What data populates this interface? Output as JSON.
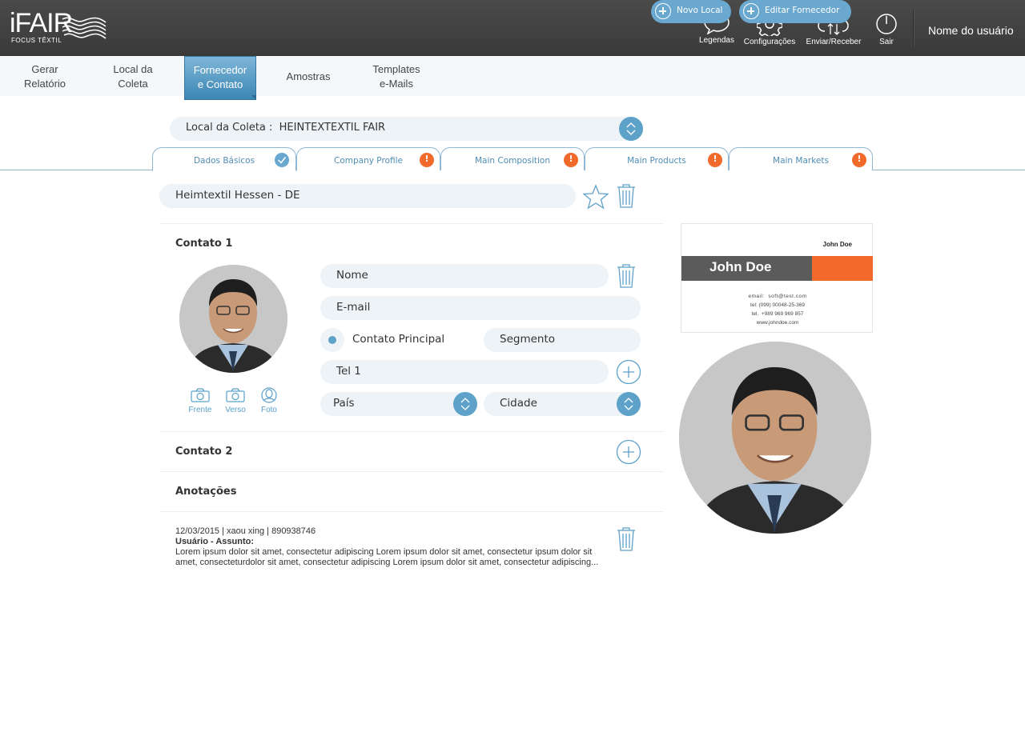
{
  "app": {
    "logo": "iFAIR",
    "logo_sub": "FOCUS TÊXTIL",
    "user_name": "Nome do usuário"
  },
  "top_actions": [
    {
      "label": "Legendas",
      "icon": "speech-bubble-icon"
    },
    {
      "label": "Configurações",
      "icon": "gear-icon"
    },
    {
      "label": "Enviar/Receber",
      "icon": "cloud-sync-icon"
    },
    {
      "label": "Sair",
      "icon": "power-icon"
    }
  ],
  "nav": [
    {
      "label": "Gerar\nRelatório"
    },
    {
      "label": "Local da\nColeta"
    },
    {
      "label": "Fornecedor\ne Contato",
      "active": true
    },
    {
      "label": "Amostras"
    },
    {
      "label": "Templates\ne-Mails"
    }
  ],
  "collection": {
    "label": "Local da Coleta :  HEINTEXTEXTIL FAIR",
    "new_place": "Novo Local",
    "edit_supplier": "Editar Fornecedor"
  },
  "subtabs": [
    {
      "label": "Dados Básicos",
      "status": "ok"
    },
    {
      "label": "Company Profile",
      "status": "warn"
    },
    {
      "label": "Main Composition",
      "status": "warn"
    },
    {
      "label": "Main Products",
      "status": "warn"
    },
    {
      "label": "Main Markets",
      "status": "warn"
    }
  ],
  "supplier": {
    "name": "Heimtextil Hessen - DE"
  },
  "contact1": {
    "title": "Contato 1",
    "name_placeholder": "Nome",
    "email_placeholder": "E-mail",
    "main_contact_label": "Contato Principal",
    "segment_placeholder": "Segmento",
    "phone_placeholder": "Tel 1",
    "country_placeholder": "País",
    "city_placeholder": "Cidade",
    "photo_buttons": [
      "Frente",
      "Verso",
      "Foto"
    ]
  },
  "contact2": {
    "title": "Contato 2"
  },
  "notes": {
    "title": "Anotações",
    "items": [
      {
        "meta": "12/03/2015 | xaou xing | 890938746",
        "subject": "Usuário - Assunto:",
        "body": "Lorem ipsum dolor sit amet, consectetur adipiscing Lorem ipsum dolor sit amet, consectetur ipsum dolor sit amet, consecteturdolor sit amet, consectetur adipiscing Lorem ipsum dolor sit amet, consectetur adipiscing..."
      }
    ]
  },
  "business_card": {
    "small_name": "John Doe",
    "name": "John Doe",
    "email": "email:  soft@test.com",
    "tel": "tel: (099) 00048-25-369",
    "tel2": "tel.  +989 969 969 857",
    "web": "www.johndoe.com"
  },
  "colors": {
    "accent": "#5ea1c9",
    "warning": "#f26a2b",
    "topbar": "#424242"
  }
}
